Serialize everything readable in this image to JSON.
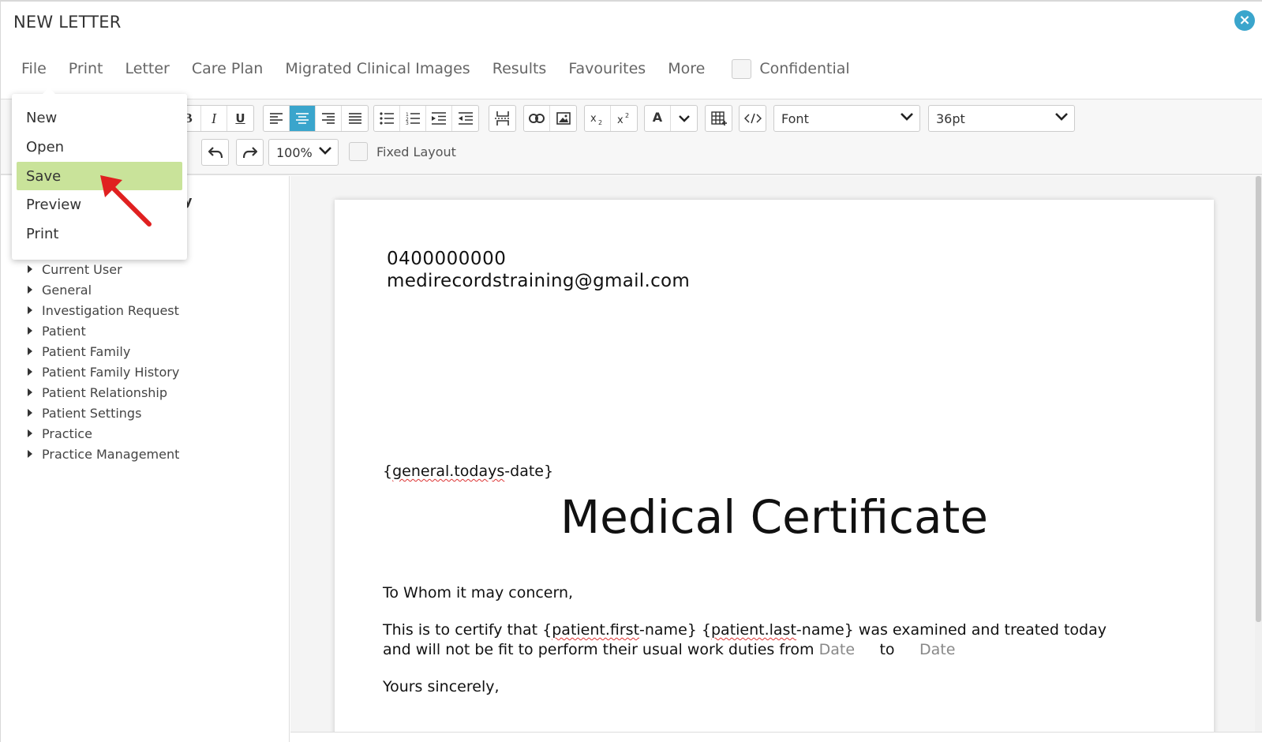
{
  "window": {
    "title": "NEW LETTER",
    "close_symbol": "×"
  },
  "menu": {
    "items": [
      "File",
      "Print",
      "Letter",
      "Care Plan",
      "Migrated Clinical Images",
      "Results",
      "Favourites",
      "More"
    ],
    "confidential_label": "Confidential"
  },
  "file_menu": {
    "items": [
      "New",
      "Open",
      "Save",
      "Preview",
      "Print"
    ],
    "highlighted": "Save"
  },
  "toolbar": {
    "bold": "B",
    "italic": "I",
    "underline": "U",
    "font_color": "A",
    "font_select": "Font",
    "size_select": "36pt",
    "zoom_select": "100%",
    "fixed_layout_label": "Fixed Layout",
    "active_color": "#3aa5cc"
  },
  "tree": {
    "items": [
      "Current User",
      "General",
      "Investigation Request",
      "Patient",
      "Patient Family",
      "Patient Family History",
      "Patient Relationship",
      "Patient Settings",
      "Practice",
      "Practice Management"
    ],
    "partial_heading": "y"
  },
  "letter": {
    "phone": "0400000000",
    "email": "medirecordstraining@gmail.com",
    "date_field": {
      "open": "{",
      "wavy": "general.todays",
      "rest": "-date}"
    },
    "title": "Medical Certificate",
    "greeting": "To Whom it may concern,",
    "body1": {
      "a": "This is to certify that {",
      "w1": "patient.first",
      "b": "-name} {",
      "w2": "patient.last",
      "c": "-name} was examined and treated today"
    },
    "body2": {
      "a": "and will not be fit to perform their usual work duties from ",
      "date1": "Date",
      "to": "to",
      "date2": "Date"
    },
    "closing": "Yours sincerely,"
  },
  "colors": {
    "highlight": "#c9e39a",
    "accent": "#3aa5cc",
    "arrow": "#e02020"
  }
}
